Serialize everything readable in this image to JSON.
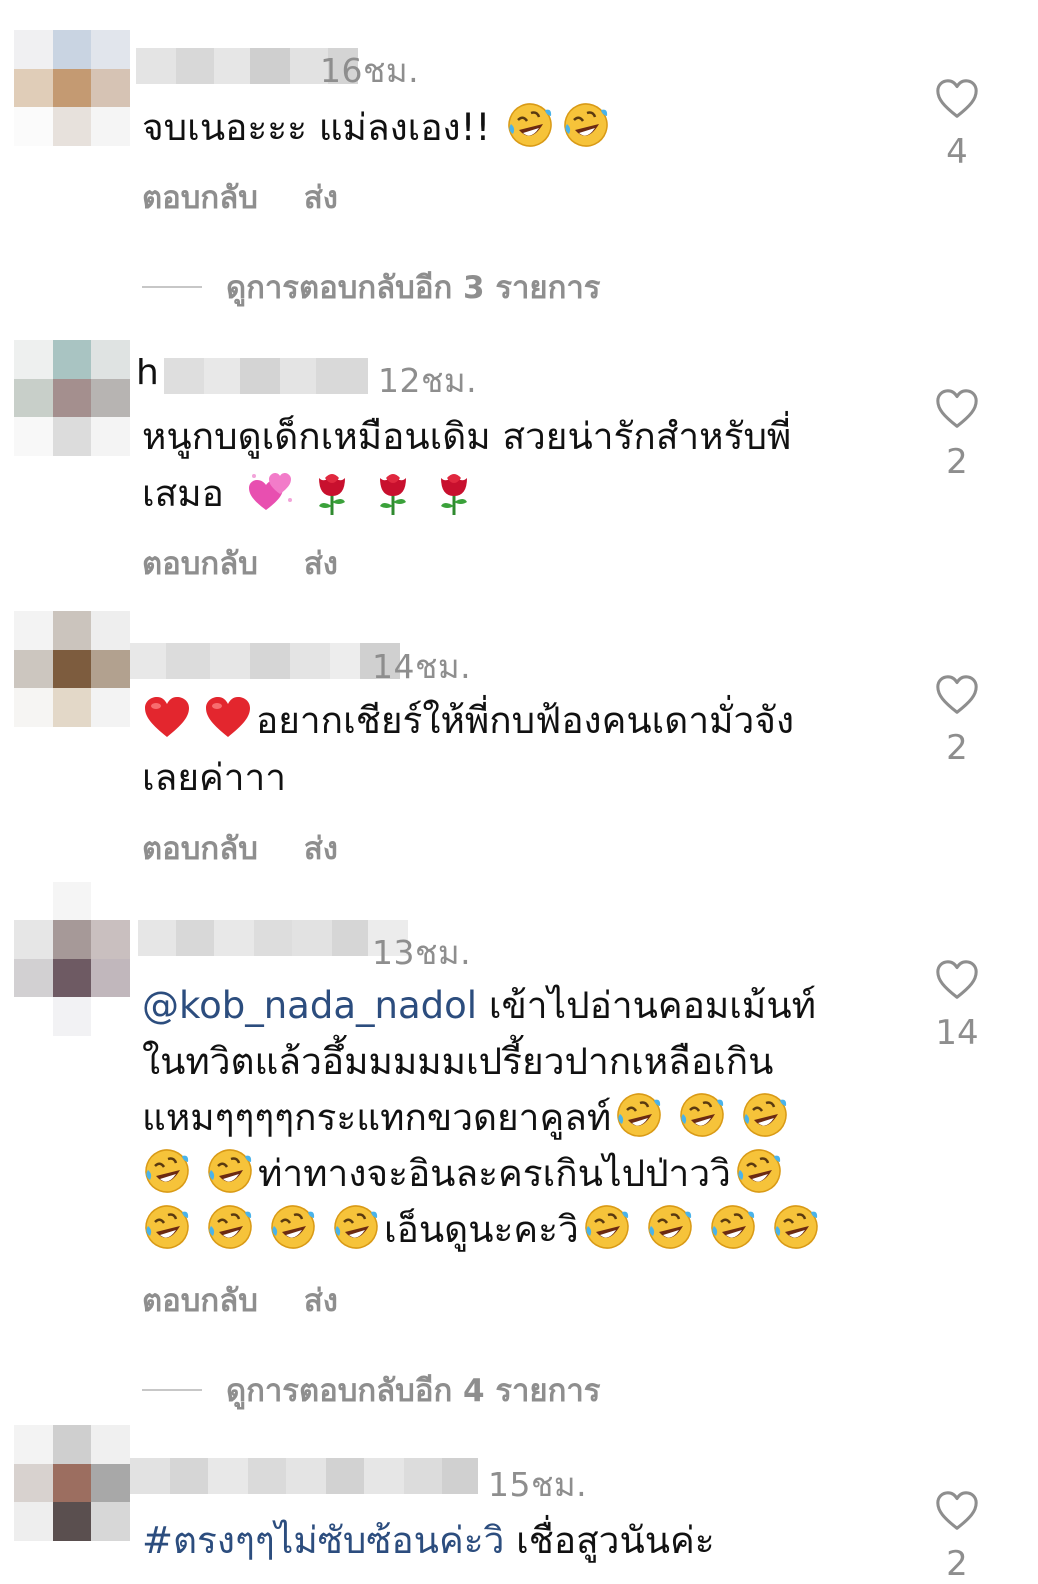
{
  "actions": {
    "reply_label": "ตอบกลับ",
    "send_label": "ส่ง"
  },
  "comments": [
    {
      "time": "16ชม.",
      "text": "จบเนอะะะ แม่ลงเอง!!",
      "emojis": [
        "rofl",
        "rofl"
      ],
      "likes": "4",
      "view_replies": "ดูการตอบกลับอีก 3 รายการ"
    },
    {
      "username_partial": "h",
      "time": "12ชม.",
      "text_line1": "หนูกบดูเด็กเหมือนเดิม สวยน่ารักสำหรับพี่",
      "text_line2": "เสมอ",
      "emojis": [
        "hearts",
        "rose",
        "rose",
        "rose"
      ],
      "likes": "2"
    },
    {
      "time": "14ชม.",
      "text_line1": "อยากเชียร์ให้พี่กบฟ้องคนเดามั่วจัง",
      "text_line2": "เลยค่าาา",
      "emojis": [
        "heart",
        "heart"
      ],
      "likes": "2"
    },
    {
      "time": "13ชม.",
      "mention": "@kob_nada_nadol",
      "text_line1": "เข้าไปอ่านคอมเม้นท์",
      "text_line2": "ในทวิตแล้วอึ้มมมมมเปรี้ยวปากเหลือเกิน",
      "text_line3": "แหมๆๆๆๆกระแทกขวดยาคูลท์",
      "text_line4": "ท่าทางจะอินละครเกินไปป่าววิ",
      "text_line5": "เอ็นดูนะคะวิ",
      "likes": "14",
      "view_replies": "ดูการตอบกลับอีก 4 รายการ"
    },
    {
      "time": "15ชม.",
      "hashtag": "#ตรงๆๆไม่ซับซ้อนค่ะวิ",
      "text_line1": "เชื่อสูวนันค่ะ",
      "likes": "2"
    }
  ]
}
